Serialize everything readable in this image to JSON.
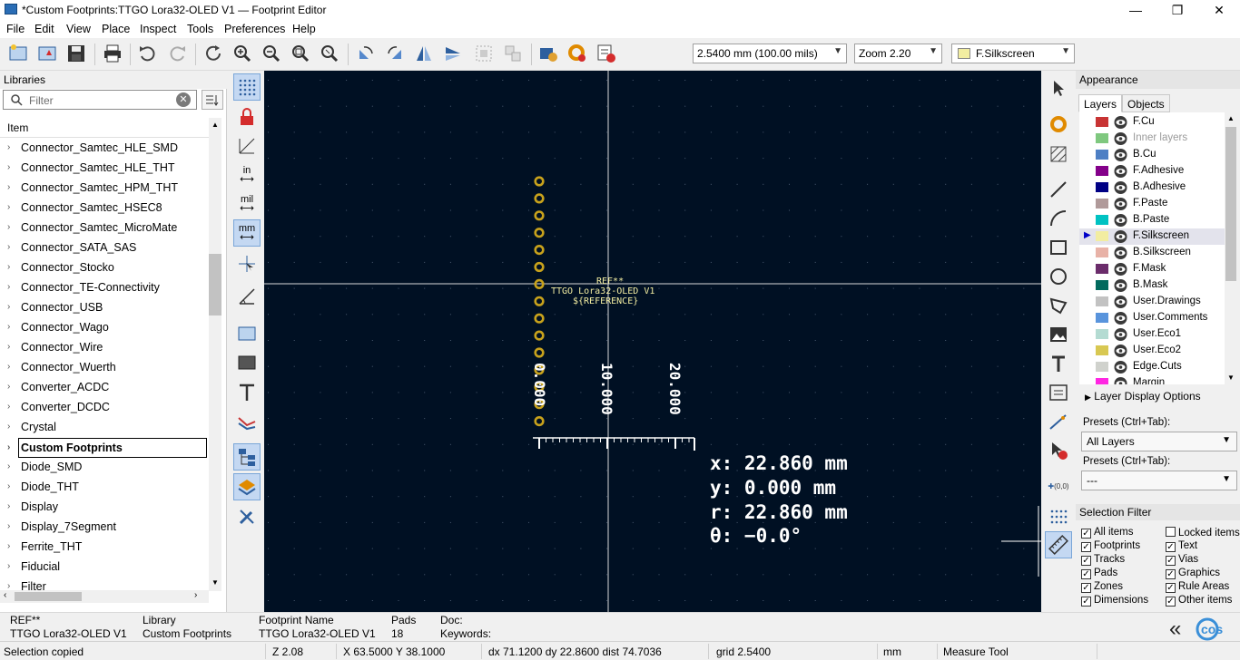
{
  "window": {
    "title": "*Custom Footprints:TTGO Lora32-OLED V1 — Footprint Editor",
    "minimize": "—",
    "maximize": "❐",
    "close": "✕"
  },
  "menu": [
    "File",
    "Edit",
    "View",
    "Place",
    "Inspect",
    "Tools",
    "Preferences",
    "Help"
  ],
  "toolbar": {
    "grid_value": "2.5400 mm (100.00 mils)",
    "zoom_value": "Zoom 2.20",
    "layer_value": "F.Silkscreen",
    "layer_color": "#f2eda1"
  },
  "libraries": {
    "header": "Libraries",
    "filter_placeholder": "Filter",
    "column_header": "Item",
    "items": [
      "Connector_Samtec_HLE_SMD",
      "Connector_Samtec_HLE_THT",
      "Connector_Samtec_HPM_THT",
      "Connector_Samtec_HSEC8",
      "Connector_Samtec_MicroMate",
      "Connector_SATA_SAS",
      "Connector_Stocko",
      "Connector_TE-Connectivity",
      "Connector_USB",
      "Connector_Wago",
      "Connector_Wire",
      "Connector_Wuerth",
      "Converter_ACDC",
      "Converter_DCDC",
      "Crystal",
      "Custom Footprints",
      "Diode_SMD",
      "Diode_THT",
      "Display",
      "Display_7Segment",
      "Ferrite_THT",
      "Fiducial",
      "Filter"
    ],
    "selected": "Custom Footprints"
  },
  "canvas": {
    "ref_text": "REF**",
    "value_text": "TTGO Lora32-OLED V1",
    "ref_field": "${REFERENCE}",
    "ruler_labels": [
      "0.000",
      "10.000",
      "20.000"
    ],
    "measure_x": "x: 22.860 mm",
    "measure_y": "y: 0.000 mm",
    "measure_r": "r: 22.860 mm",
    "measure_theta": "θ: −0.0°",
    "pad_count_drawn": 15,
    "colors": {
      "background": "#001023",
      "pad": "#c8a21c",
      "silk": "#f2eda1",
      "ruler": "#ffffff"
    }
  },
  "appearance": {
    "header": "Appearance",
    "tab_layers": "Layers",
    "tab_objects": "Objects",
    "layers": [
      {
        "name": "F.Cu",
        "color": "#c83434",
        "dim": false
      },
      {
        "name": "Inner layers",
        "color": "#7fc87f",
        "dim": true
      },
      {
        "name": "B.Cu",
        "color": "#4d7fc4",
        "dim": false
      },
      {
        "name": "F.Adhesive",
        "color": "#84008a",
        "dim": false
      },
      {
        "name": "B.Adhesive",
        "color": "#000084",
        "dim": false
      },
      {
        "name": "F.Paste",
        "color": "#b09a9a",
        "dim": false
      },
      {
        "name": "B.Paste",
        "color": "#00c2c2",
        "dim": false
      },
      {
        "name": "F.Silkscreen",
        "color": "#f2eda1",
        "dim": false
      },
      {
        "name": "B.Silkscreen",
        "color": "#e8b2a7",
        "dim": false
      },
      {
        "name": "F.Mask",
        "color": "#6b2c6b",
        "dim": false
      },
      {
        "name": "B.Mask",
        "color": "#026a5e",
        "dim": false
      },
      {
        "name": "User.Drawings",
        "color": "#c2c2c2",
        "dim": false
      },
      {
        "name": "User.Comments",
        "color": "#5994dc",
        "dim": false
      },
      {
        "name": "User.Eco1",
        "color": "#b4dbd2",
        "dim": false
      },
      {
        "name": "User.Eco2",
        "color": "#d8c852",
        "dim": false
      },
      {
        "name": "Edge.Cuts",
        "color": "#d0d2cd",
        "dim": false
      },
      {
        "name": "Margin",
        "color": "#ff26e2",
        "dim": false
      }
    ],
    "selected_layer": "F.Silkscreen",
    "layer_display_options": "Layer Display Options",
    "presets_label_1": "Presets (Ctrl+Tab):",
    "presets_value_1": "All Layers",
    "presets_label_2": "Presets (Ctrl+Tab):",
    "presets_value_2": "---"
  },
  "selection_filter": {
    "header": "Selection Filter",
    "items": [
      {
        "label": "All items",
        "checked": true
      },
      {
        "label": "Locked items",
        "checked": false
      },
      {
        "label": "Footprints",
        "checked": true
      },
      {
        "label": "Text",
        "checked": true
      },
      {
        "label": "Tracks",
        "checked": true
      },
      {
        "label": "Vias",
        "checked": true
      },
      {
        "label": "Pads",
        "checked": true
      },
      {
        "label": "Graphics",
        "checked": true
      },
      {
        "label": "Zones",
        "checked": true
      },
      {
        "label": "Rule Areas",
        "checked": true
      },
      {
        "label": "Dimensions",
        "checked": true
      },
      {
        "label": "Other items",
        "checked": true
      }
    ]
  },
  "info": {
    "ref": "REF**",
    "value": "TTGO Lora32-OLED V1",
    "library_label": "Library",
    "library_value": "Custom Footprints",
    "fpname_label": "Footprint Name",
    "fpname_value": "TTGO Lora32-OLED V1",
    "pads_label": "Pads",
    "pads_value": "18",
    "doc_label": "Doc:",
    "keywords_label": "Keywords:",
    "collapse": "«"
  },
  "status": {
    "message": "Selection copied",
    "zoom": "Z 2.08",
    "xy": "X 63.5000  Y 38.1000",
    "delta": "dx 71.1200  dy 22.8600  dist 74.7036",
    "grid": "grid 2.5400",
    "units": "mm",
    "tool": "Measure Tool"
  }
}
